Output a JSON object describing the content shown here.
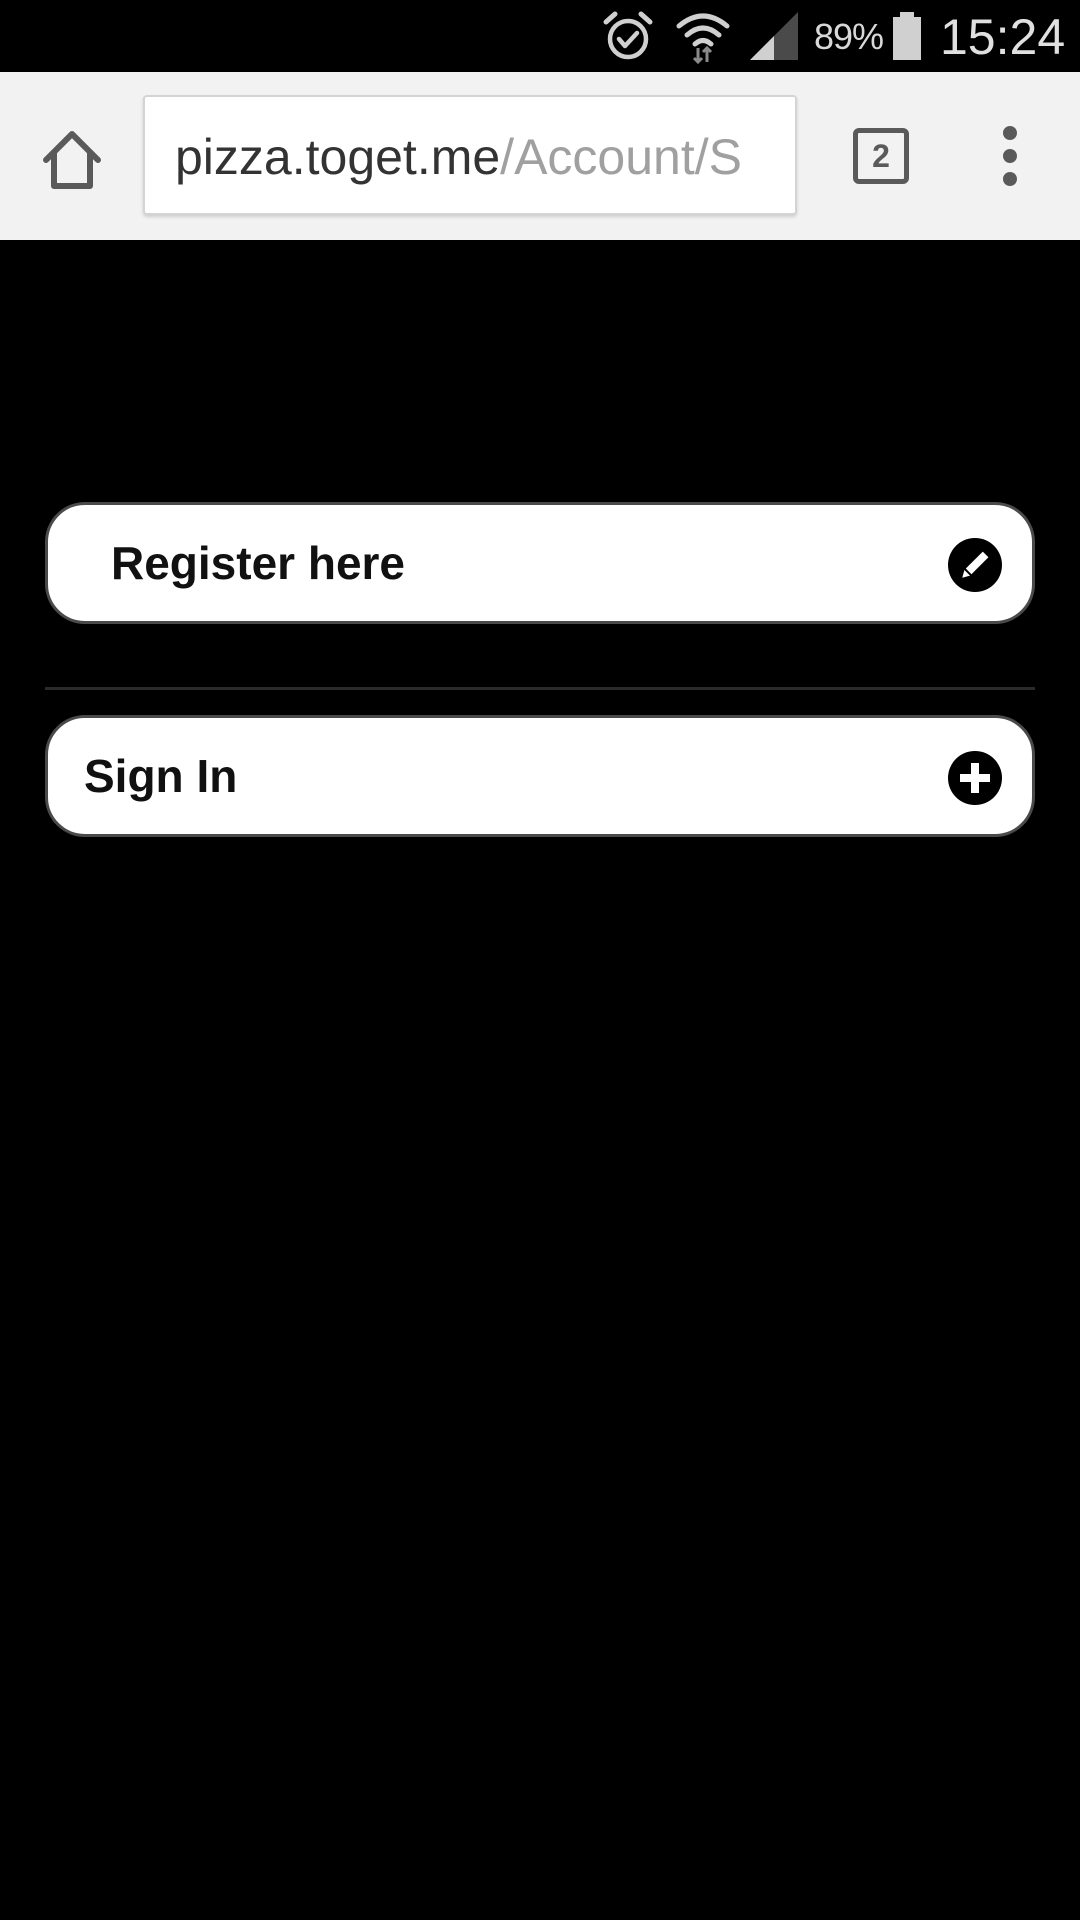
{
  "status_bar": {
    "battery_percent": "89%",
    "time": "15:24",
    "icons": [
      "alarm-icon",
      "wifi-icon",
      "signal-icon",
      "battery-icon"
    ]
  },
  "browser": {
    "url_host": "pizza.toget.me",
    "url_path": "/Account/S",
    "tab_count": "2",
    "icons": [
      "home-icon",
      "tabs-icon",
      "overflow-menu-icon"
    ]
  },
  "page": {
    "register_label": "Register here",
    "register_icon": "pencil-icon",
    "signin_label": "Sign In",
    "signin_icon": "plus-circle-icon"
  },
  "colors": {
    "page_background": "#000000",
    "toolbar_background": "#f2f2f2",
    "button_background": "#ffffff"
  }
}
